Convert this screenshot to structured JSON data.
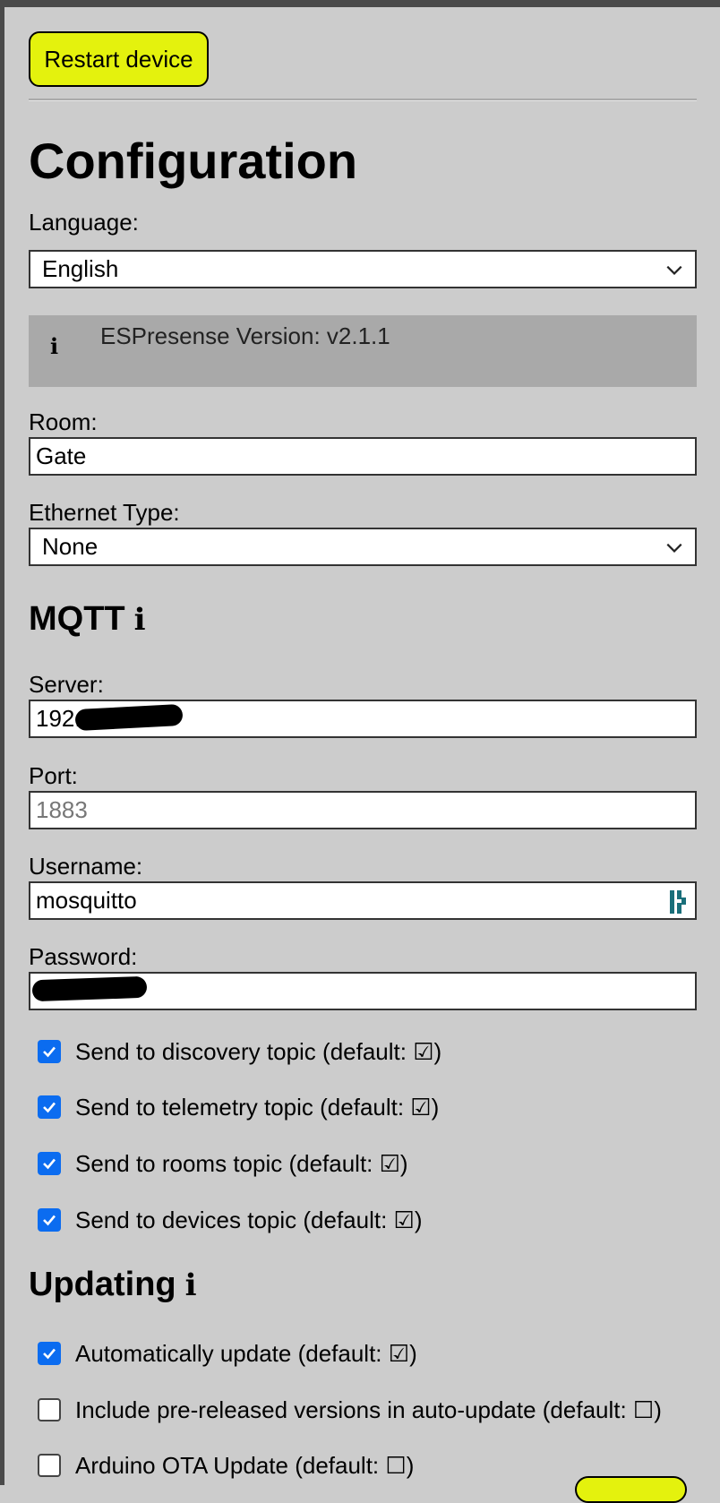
{
  "header": {
    "restart_label": "Restart device"
  },
  "page_title": "Configuration",
  "language": {
    "label": "Language:",
    "value": "English"
  },
  "info": {
    "text": "ESPresense Version: v2.1.1",
    "icon": "i"
  },
  "room": {
    "label": "Room:",
    "value": "Gate"
  },
  "ethernet": {
    "label": "Ethernet Type:",
    "value": "None"
  },
  "mqtt": {
    "title": "MQTT",
    "info_icon": "i",
    "server_label": "Server:",
    "server_value": "192.",
    "port_label": "Port:",
    "port_placeholder": "1883",
    "username_label": "Username:",
    "username_value": "mosquitto",
    "password_label": "Password:",
    "checks": [
      {
        "label": "Send to discovery topic (default: ☑)",
        "checked": true
      },
      {
        "label": "Send to telemetry topic (default: ☑)",
        "checked": true
      },
      {
        "label": "Send to rooms topic (default: ☑)",
        "checked": true
      },
      {
        "label": "Send to devices topic (default: ☑)",
        "checked": true
      }
    ]
  },
  "updating": {
    "title": "Updating",
    "info_icon": "i",
    "checks": [
      {
        "label": "Automatically update (default: ☑)",
        "checked": true
      },
      {
        "label": "Include pre-released versions in auto-update (default: ☐)",
        "checked": false
      },
      {
        "label": "Arduino OTA Update (default: ☐)",
        "checked": false
      }
    ]
  },
  "colors": {
    "accent_button": "#e4f20d",
    "checkbox": "#0b6cf0",
    "background": "#cccccc"
  }
}
